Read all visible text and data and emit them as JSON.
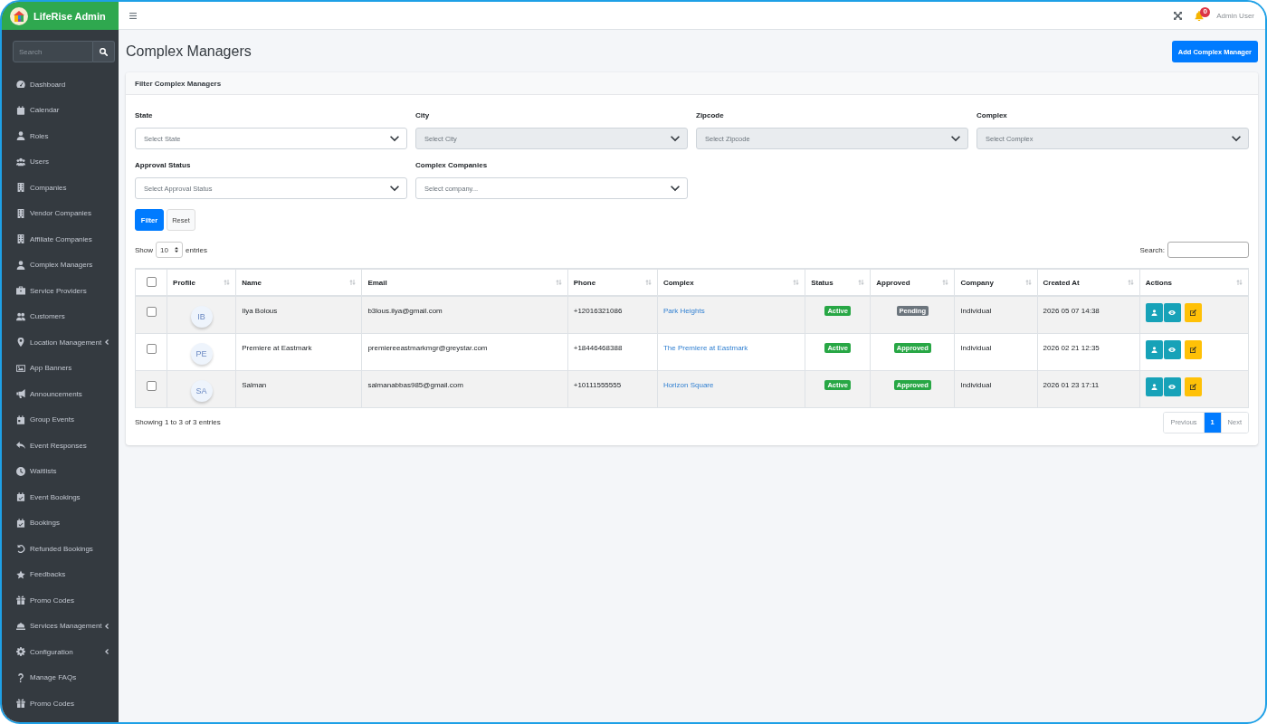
{
  "brand": {
    "title": "LifeRise Admin"
  },
  "sidebar": {
    "search": {
      "placeholder": "Search"
    },
    "items": [
      {
        "label": "Dashboard",
        "submenu": false
      },
      {
        "label": "Calendar",
        "submenu": false
      },
      {
        "label": "Roles",
        "submenu": false
      },
      {
        "label": "Users",
        "submenu": false
      },
      {
        "label": "Companies",
        "submenu": false
      },
      {
        "label": "Vendor Companies",
        "submenu": false
      },
      {
        "label": "Affiliate Companies",
        "submenu": false
      },
      {
        "label": "Complex Managers",
        "submenu": false
      },
      {
        "label": "Service Providers",
        "submenu": false
      },
      {
        "label": "Customers",
        "submenu": false
      },
      {
        "label": "Location Management",
        "submenu": true
      },
      {
        "label": "App Banners",
        "submenu": false
      },
      {
        "label": "Announcements",
        "submenu": false
      },
      {
        "label": "Group Events",
        "submenu": false
      },
      {
        "label": "Event Responses",
        "submenu": false
      },
      {
        "label": "Waitlists",
        "submenu": false
      },
      {
        "label": "Event Bookings",
        "submenu": false
      },
      {
        "label": "Bookings",
        "submenu": false
      },
      {
        "label": "Refunded Bookings",
        "submenu": false
      },
      {
        "label": "Feedbacks",
        "submenu": false
      },
      {
        "label": "Promo Codes",
        "submenu": false
      },
      {
        "label": "Services Management",
        "submenu": true
      },
      {
        "label": "Configuration",
        "submenu": true
      },
      {
        "label": "Manage FAQs",
        "submenu": false
      },
      {
        "label": "Promo Codes",
        "submenu": false
      }
    ]
  },
  "topbar": {
    "notification_count": "0",
    "user": "Admin User"
  },
  "page": {
    "title": "Complex Managers",
    "add_button": "Add Complex Manager"
  },
  "filter": {
    "title": "Filter Complex Managers",
    "fields": [
      {
        "label": "State",
        "placeholder": "Select State",
        "disabled": false
      },
      {
        "label": "City",
        "placeholder": "Select City",
        "disabled": true
      },
      {
        "label": "Zipcode",
        "placeholder": "Select Zipcode",
        "disabled": true
      },
      {
        "label": "Complex",
        "placeholder": "Select Complex",
        "disabled": true
      },
      {
        "label": "Approval Status",
        "placeholder": "Select Approval Status",
        "disabled": false
      },
      {
        "label": "Complex Companies",
        "placeholder": "Select company...",
        "disabled": false
      }
    ],
    "buttons": [
      {
        "label": "Filter",
        "kind": "primary"
      },
      {
        "label": "Reset",
        "kind": "secondary"
      }
    ]
  },
  "table": {
    "length": {
      "before": "Show",
      "value": "10",
      "after": "entries"
    },
    "search_label": "Search:",
    "header_checkbox": {
      "checked": false
    },
    "columns": [
      "Profile",
      "Name",
      "Email",
      "Phone",
      "Complex",
      "Status",
      "Approved",
      "Company",
      "Created At",
      "Actions"
    ],
    "rows": [
      {
        "checked": false,
        "initials": "IB",
        "name": "Ilya Bolous",
        "email": "b3lous.ilya@gmail.com",
        "phone": "+12016321086",
        "complex": "Park Heights",
        "status": {
          "text": "Active",
          "color": "#28a745"
        },
        "approved": {
          "text": "Pending",
          "color": "#6c757d"
        },
        "company": "Individual",
        "created_at": "2026 05 07 14:38"
      },
      {
        "checked": false,
        "initials": "PE",
        "name": "Premiere at Eastmark",
        "email": "premiereeastmarkmgr@greystar.com",
        "phone": "+18446468388",
        "complex": "The Premiere at Eastmark",
        "status": {
          "text": "Active",
          "color": "#28a745"
        },
        "approved": {
          "text": "Approved",
          "color": "#28a745"
        },
        "company": "Individual",
        "created_at": "2026 02 21 12:35"
      },
      {
        "checked": false,
        "initials": "SA",
        "name": "Salman",
        "email": "salmanabbas985@gmail.com",
        "phone": "+10111555555",
        "complex": "Horizon Square",
        "status": {
          "text": "Active",
          "color": "#28a745"
        },
        "approved": {
          "text": "Approved",
          "color": "#28a745"
        },
        "company": "Individual",
        "created_at": "2026 01 23 17:11"
      }
    ],
    "info": "Showing 1 to 3 of 3 entries",
    "pagination": {
      "previous": {
        "label": "Previous",
        "disabled": true
      },
      "pages": [
        {
          "label": "1",
          "selected": true
        }
      ],
      "next": {
        "label": "Next",
        "disabled": true
      }
    }
  }
}
